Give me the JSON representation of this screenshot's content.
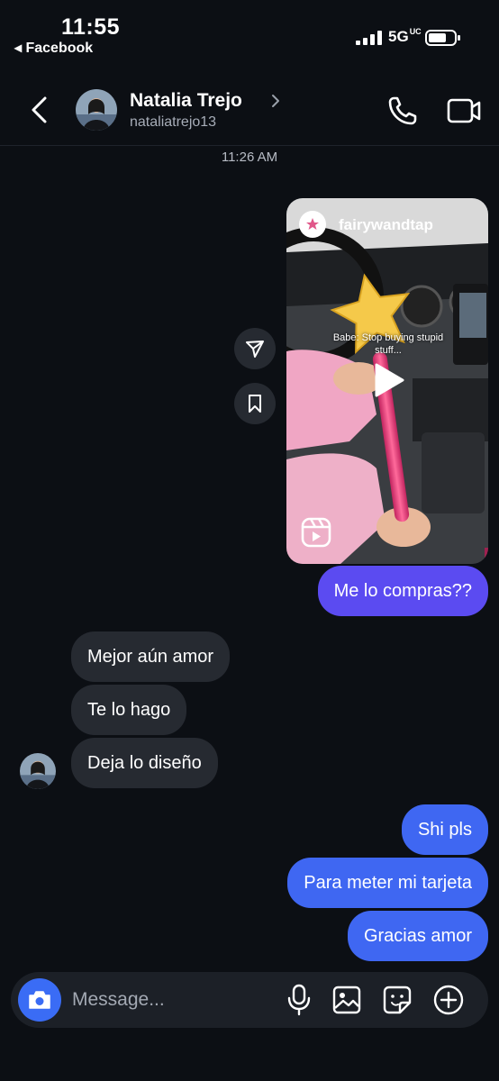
{
  "status_bar": {
    "time": "11:55",
    "back_app": "◂ Facebook",
    "network": "5G",
    "network_sub": "UC"
  },
  "header": {
    "name": "Natalia Trejo",
    "username": "nataliatrejo13"
  },
  "thread": {
    "timestamp": "11:26 AM",
    "shared_video": {
      "account": "fairywandtap",
      "overlay_text": "Babe: Stop buying stupid stuff..."
    },
    "messages": [
      {
        "text": "Me lo compras??",
        "direction": "out"
      },
      {
        "text": "Mejor aún amor",
        "direction": "in"
      },
      {
        "text": "Te lo hago",
        "direction": "in"
      },
      {
        "text": "Deja lo diseño",
        "direction": "in"
      },
      {
        "text": "Shi pls",
        "direction": "out"
      },
      {
        "text": "Para meter mi tarjeta",
        "direction": "out"
      },
      {
        "text": "Gracias amor",
        "direction": "out"
      }
    ]
  },
  "composer": {
    "placeholder": "Message..."
  },
  "colors": {
    "background": "#0c0f14",
    "outgoing_first": "#5b4bf1",
    "outgoing": "#3f67f2",
    "incoming": "#262a31",
    "camera_button": "#3a6cf5"
  }
}
